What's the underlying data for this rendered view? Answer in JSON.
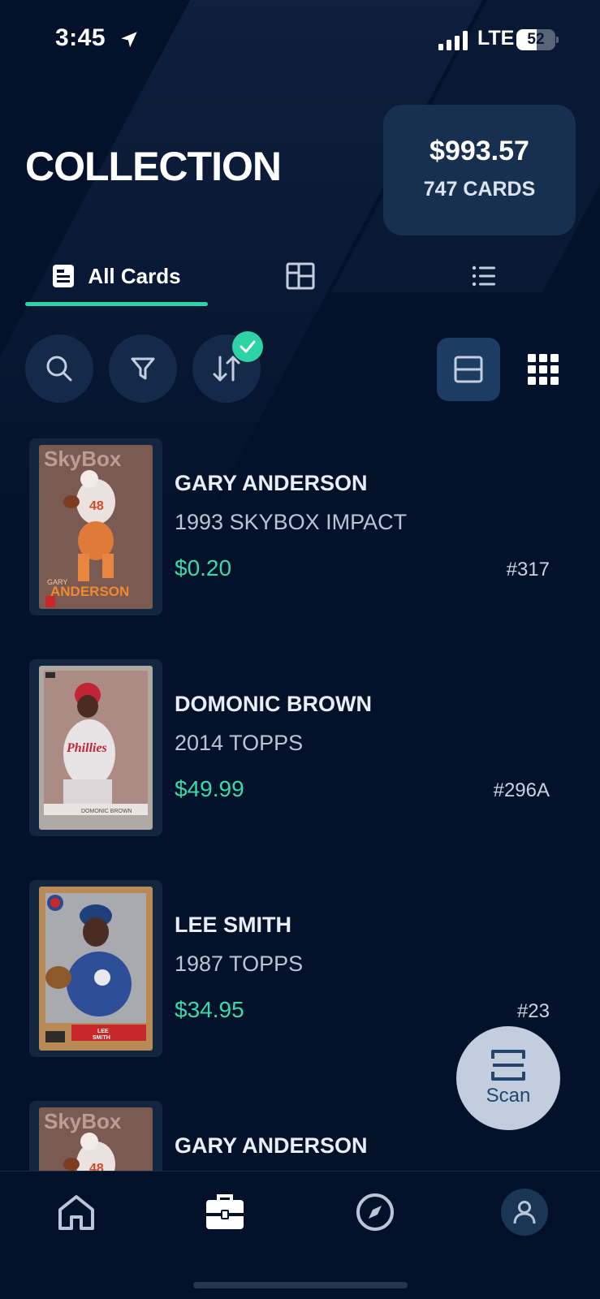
{
  "status_bar": {
    "time": "3:45",
    "network": "LTE",
    "battery_percent": "52",
    "battery_level": 0.52
  },
  "header": {
    "title": "COLLECTION",
    "summary": {
      "total_value": "$993.57",
      "card_count": "747 CARDS"
    }
  },
  "tabs": [
    {
      "label": "All Cards",
      "icon": "document-icon",
      "active": true
    },
    {
      "label": "",
      "icon": "layout-grid-icon",
      "active": false
    },
    {
      "label": "",
      "icon": "list-icon",
      "active": false
    }
  ],
  "toolbar": {
    "search_icon": "search-icon",
    "filter_icon": "filter-icon",
    "sort_icon": "sort-icon",
    "sort_active": true,
    "view_modes": [
      "single-row-view-icon",
      "grid-view-icon"
    ],
    "selected_view": "single-row-view-icon"
  },
  "cards": [
    {
      "player": "GARY ANDERSON",
      "set": "1993 SKYBOX IMPACT",
      "price": "$0.20",
      "number": "#317",
      "card_image": "skybox-1993-card"
    },
    {
      "player": "DOMONIC BROWN",
      "set": "2014 TOPPS",
      "price": "$49.99",
      "number": "#296A",
      "card_image": "topps-2014-card"
    },
    {
      "player": "LEE SMITH",
      "set": "1987 TOPPS",
      "price": "$34.95",
      "number": "#23",
      "card_image": "topps-1987-card"
    },
    {
      "player": "GARY ANDERSON",
      "set": "",
      "price": "",
      "number": "",
      "card_image": "skybox-1993-card"
    }
  ],
  "scan_button": {
    "label": "Scan"
  },
  "bottom_nav": [
    {
      "name": "home",
      "icon": "home-icon"
    },
    {
      "name": "collection",
      "icon": "briefcase-icon",
      "active": true
    },
    {
      "name": "explore",
      "icon": "compass-icon"
    },
    {
      "name": "profile",
      "icon": "user-icon"
    }
  ],
  "colors": {
    "background": "#04112a",
    "accent": "#2ed3a5",
    "price": "#38dba8",
    "surface": "#17304f"
  }
}
